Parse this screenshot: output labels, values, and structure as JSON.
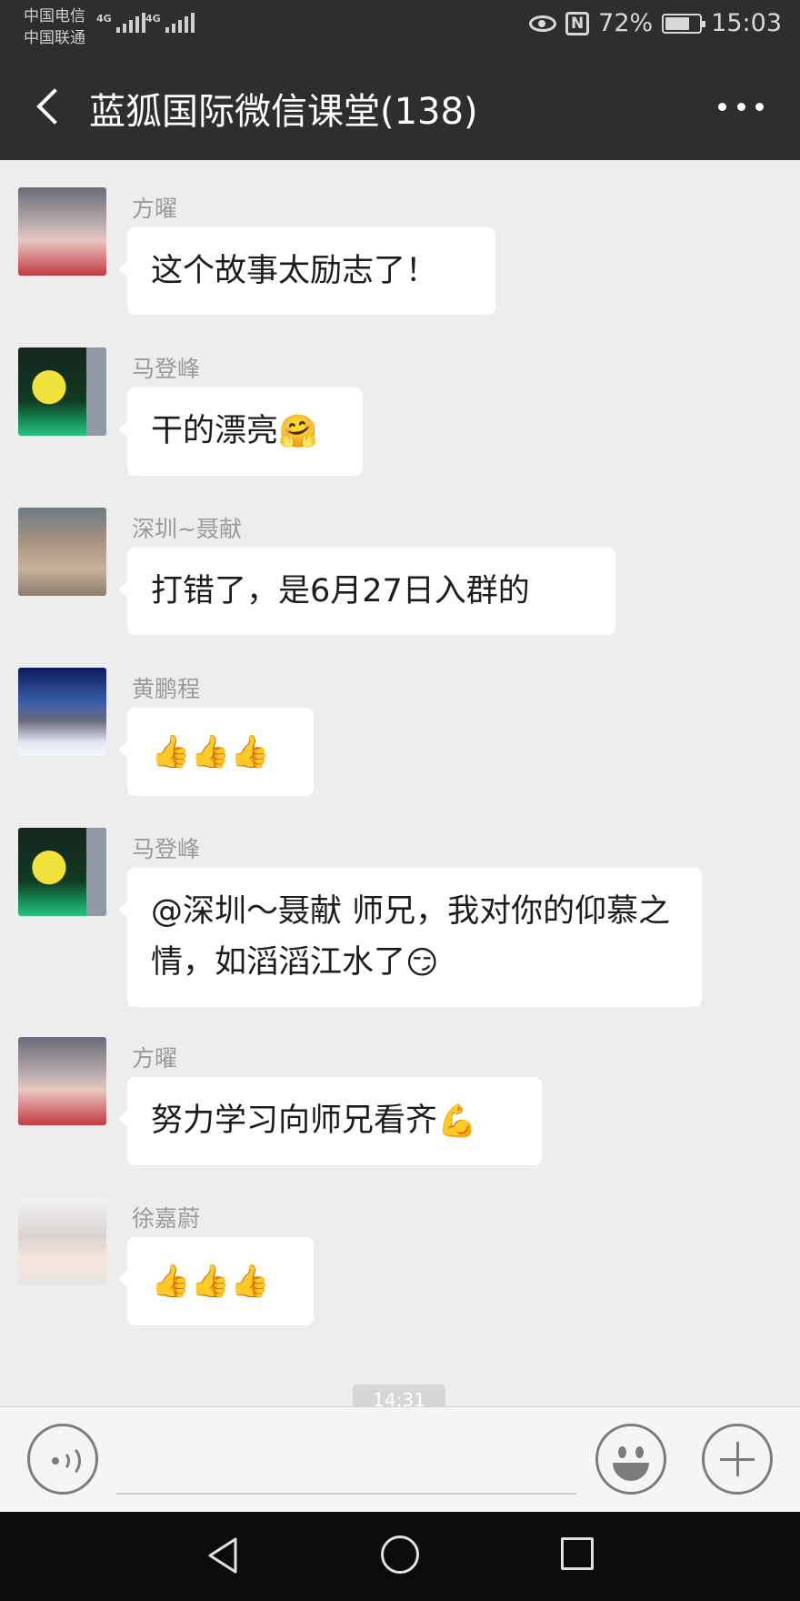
{
  "status_bar": {
    "carrier1": "中国电信",
    "carrier2": "中国联通",
    "network1": "4G",
    "network2": "4G",
    "nfc_label": "N",
    "battery": "72%",
    "battery_level": 0.72,
    "time": "15:03"
  },
  "header": {
    "title": "蓝狐国际微信课堂(138)",
    "back_icon": "chevron-left-icon",
    "more_icon": "more-dots-icon"
  },
  "messages": [
    {
      "sender": "方曜",
      "text": "这个故事太励志了！",
      "emoji": "",
      "avatar": "avatar-girl-portrait"
    },
    {
      "sender": "马登峰",
      "text": "干的漂亮",
      "emoji": "🤗",
      "avatar": "avatar-ginkgo-leaf"
    },
    {
      "sender": "深圳~聂献",
      "text": "打错了，是6月27日入群的",
      "emoji": "",
      "avatar": "avatar-old-street"
    },
    {
      "sender": "黄鹏程",
      "text": "",
      "emoji": "👍👍👍",
      "avatar": "avatar-snow-mountain"
    },
    {
      "sender": "马登峰",
      "text": "@深圳～聂献  师兄，我对你的仰慕之情，如滔滔江水了",
      "emoji": "😏",
      "avatar": "avatar-ginkgo-leaf"
    },
    {
      "sender": "方曜",
      "text": "努力学习向师兄看齐",
      "emoji": "💪",
      "avatar": "avatar-girl-portrait"
    },
    {
      "sender": "徐嘉蔚",
      "text": "",
      "emoji": "👍👍👍",
      "avatar": "avatar-woman-portrait"
    }
  ],
  "timestamp": "14:31",
  "input_bar": {
    "voice_icon": "voice-icon",
    "emoji_icon": "smiley-icon",
    "plus_icon": "plus-icon"
  },
  "system_nav": {
    "back_icon": "triangle-back-icon",
    "home_icon": "circle-home-icon",
    "recent_icon": "square-recent-icon"
  }
}
